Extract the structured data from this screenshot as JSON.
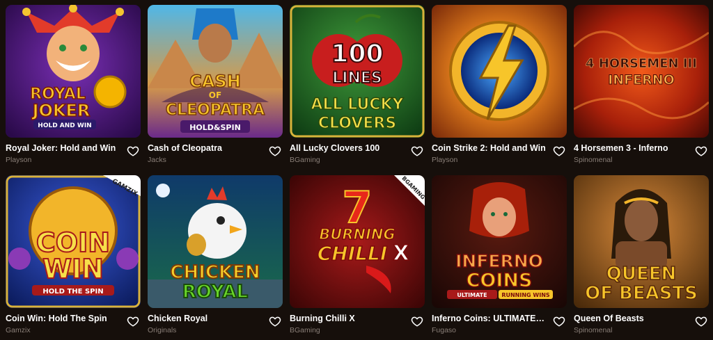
{
  "games": [
    {
      "title": "Royal Joker: Hold and Win",
      "provider": "Playson",
      "art": [
        "ROYAL",
        "JOKER",
        "HOLD AND WIN"
      ]
    },
    {
      "title": "Cash of Cleopatra",
      "provider": "Jacks",
      "art": [
        "CASH",
        "OF",
        "CLEOPATRA",
        "HOLD&SPIN"
      ]
    },
    {
      "title": "All Lucky Clovers 100",
      "provider": "BGaming",
      "art": [
        "100",
        "LINES",
        "ALL LUCKY",
        "CLOVERS"
      ]
    },
    {
      "title": "Coin Strike 2: Hold and Win",
      "provider": "Playson",
      "art": []
    },
    {
      "title": "4 Horsemen 3 - Inferno",
      "provider": "Spinomenal",
      "art": [
        "4 HORSEMEN III",
        "INFERNO"
      ]
    },
    {
      "title": "Coin Win: Hold The Spin",
      "provider": "Gamzix",
      "art": [
        "GAMZIX",
        "COIN",
        "WIN",
        "HOLD THE SPIN"
      ]
    },
    {
      "title": "Chicken Royal",
      "provider": "Originals",
      "art": [
        "CHICKEN",
        "ROYAL"
      ]
    },
    {
      "title": "Burning Chilli X",
      "provider": "BGaming",
      "art": [
        "BGAMING",
        "7",
        "BURNING",
        "CHILLI",
        "X"
      ]
    },
    {
      "title": "Inferno Coins: ULTIMATE R...",
      "provider": "Fugaso",
      "art": [
        "INFERNO",
        "COINS",
        "ULTIMATE",
        "RUNNING WINS"
      ]
    },
    {
      "title": "Queen Of Beasts",
      "provider": "Spinomenal",
      "art": [
        "QUEEN",
        "OF BEASTS"
      ]
    }
  ],
  "icons": {
    "favorite": "heart-outline-icon"
  },
  "colors": {
    "background": "#160f0b",
    "provider_text": "#8a7f78",
    "title_text": "#ffffff"
  }
}
